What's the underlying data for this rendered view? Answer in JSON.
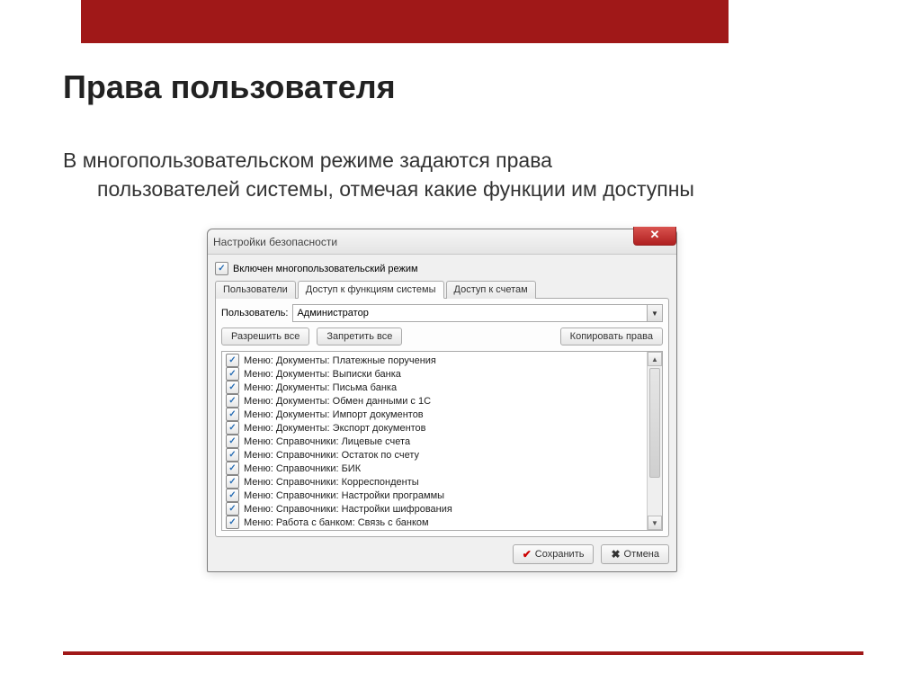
{
  "slide": {
    "title": "Права пользователя",
    "body_line1": "В многопользовательском режиме задаются права",
    "body_line2": "пользователей системы, отмечая какие функции им доступны"
  },
  "dialog": {
    "title": "Настройки безопасности",
    "multiuser_checkbox": "Включен многопользовательский режим",
    "tabs": {
      "users": "Пользователи",
      "functions": "Доступ к функциям системы",
      "accounts": "Доступ к счетам"
    },
    "user_label": "Пользователь:",
    "user_value": "Администратор",
    "buttons": {
      "allow_all": "Разрешить все",
      "deny_all": "Запретить все",
      "copy_rights": "Копировать права",
      "save": "Сохранить",
      "cancel": "Отмена"
    },
    "permissions": [
      "Меню: Документы: Платежные поручения",
      "Меню: Документы: Выписки банка",
      "Меню: Документы: Письма банка",
      "Меню: Документы: Обмен данными с 1С",
      "Меню: Документы: Импорт документов",
      "Меню: Документы: Экспорт документов",
      "Меню: Справочники: Лицевые счета",
      "Меню: Справочники: Остаток по счету",
      "Меню: Справочники: БИК",
      "Меню: Справочники: Корреспонденты",
      "Меню: Справочники: Настройки программы",
      "Меню: Справочники: Настройки шифрования",
      "Меню: Работа с банком: Связь с банком"
    ]
  }
}
